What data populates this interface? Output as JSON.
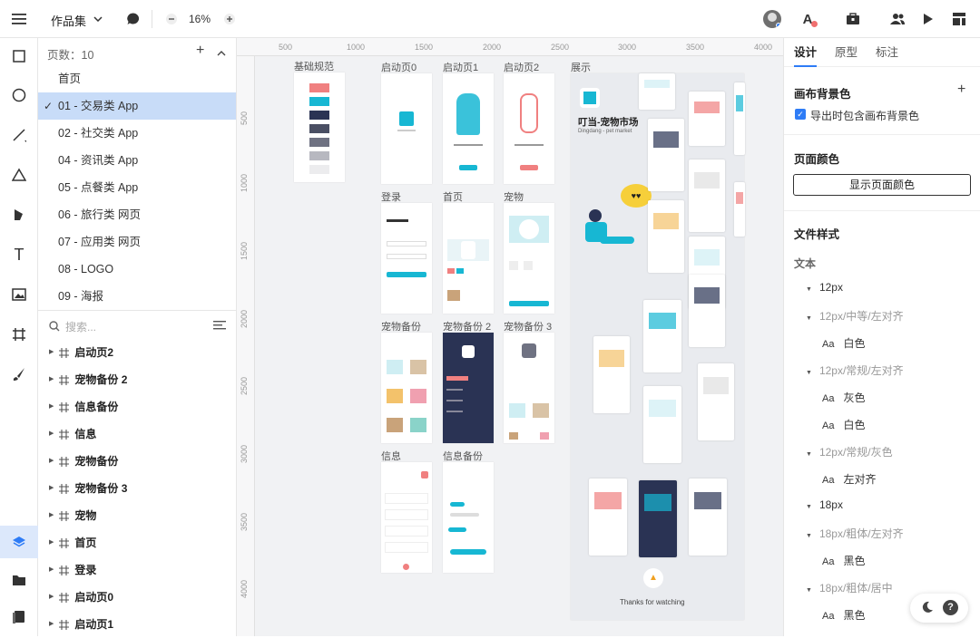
{
  "topbar": {
    "project_name": "作品集",
    "zoom": "16%"
  },
  "pages_panel": {
    "count_label": "页数：10",
    "pages": [
      "首页",
      "01 - 交易类 App",
      "02 - 社交类 App",
      "04 - 资讯类 App",
      "05 - 点餐类 App",
      "06 - 旅行类 网页",
      "07 - 应用类 网页",
      "08 - LOGO",
      "09 - 海报"
    ],
    "active_index": 1,
    "search_placeholder": "搜索...",
    "layers": [
      "启动页2",
      "宠物备份 2",
      "信息备份",
      "信息",
      "宠物备份",
      "宠物备份 3",
      "宠物",
      "首页",
      "登录",
      "启动页0",
      "启动页1"
    ]
  },
  "canvas": {
    "ruler_top": [
      "500",
      "1000",
      "1500",
      "2000",
      "2500",
      "3000",
      "3500",
      "4000"
    ],
    "ruler_left": [
      "500",
      "1000",
      "1500",
      "2000",
      "2500",
      "3000",
      "3500",
      "4000"
    ],
    "frames": {
      "basic": "基础规范",
      "splash0": "启动页0",
      "splash1": "启动页1",
      "splash2": "启动页2",
      "showcase": "展示",
      "login": "登录",
      "home": "首页",
      "pet": "宠物",
      "pet_backup": "宠物备份",
      "pet_backup2": "宠物备份 2",
      "pet_backup3": "宠物备份 3",
      "info": "信息",
      "info_backup": "信息备份"
    },
    "showcase_title": "叮当-宠物市场",
    "showcase_subtitle": "Dingdang - pet market",
    "thanks": "Thanks for watching",
    "swatches": [
      "#f08080",
      "#17b7d3",
      "#2a3354",
      "#4a4f63",
      "#6f7282",
      "#b7b8c0",
      "#ececee"
    ]
  },
  "right_panel": {
    "tabs": [
      "设计",
      "原型",
      "标注"
    ],
    "active_tab": 0,
    "canvas_bg_title": "画布背景色",
    "export_bg_label": "导出时包含画布背景色",
    "page_color_title": "页面颜色",
    "show_page_color_btn": "显示页面颜色",
    "file_style_title": "文件样式",
    "text_label": "文本",
    "styles": [
      {
        "text": "12px",
        "kind": "group",
        "level": 0
      },
      {
        "text": "12px/中等/左对齐",
        "kind": "group",
        "level": 1
      },
      {
        "text": "白色",
        "kind": "leaf",
        "level": 2
      },
      {
        "text": "12px/常规/左对齐",
        "kind": "group",
        "level": 1
      },
      {
        "text": "灰色",
        "kind": "leaf",
        "level": 2
      },
      {
        "text": "白色",
        "kind": "leaf",
        "level": 2
      },
      {
        "text": "12px/常规/灰色",
        "kind": "group",
        "level": 1
      },
      {
        "text": "左对齐",
        "kind": "leaf",
        "level": 2
      },
      {
        "text": "18px",
        "kind": "group",
        "level": 0
      },
      {
        "text": "18px/粗体/左对齐",
        "kind": "group",
        "level": 1
      },
      {
        "text": "黑色",
        "kind": "leaf",
        "level": 2
      },
      {
        "text": "18px/粗体/居中",
        "kind": "group",
        "level": 1
      },
      {
        "text": "黑色",
        "kind": "leaf",
        "level": 2
      }
    ],
    "aa_label": "Aa"
  },
  "colors": {
    "accent": "#2e7cf6",
    "active_page_bg": "#c8dcf8",
    "brand_teal": "#17b7d3",
    "brand_pink": "#f08080",
    "navy": "#2a3354"
  }
}
